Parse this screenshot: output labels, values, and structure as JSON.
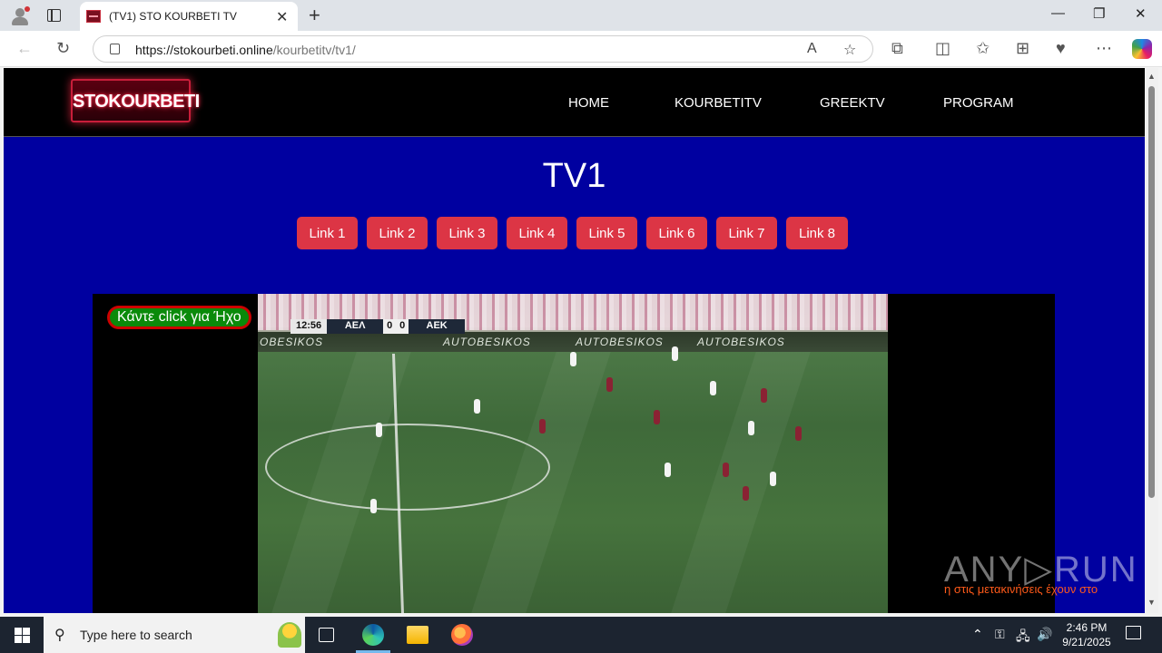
{
  "browser": {
    "tab_title": "(TV1) STO KOURBETI TV",
    "tab_close": "✕",
    "new_tab": "+",
    "url_host": "https://stokourbeti.online",
    "url_path": "/kourbetitv/tv1/",
    "window_controls": [
      "—",
      "❐",
      "✕"
    ]
  },
  "site": {
    "logo": "STOKOURBETI",
    "nav": [
      "HOME",
      "KOURBETITV",
      "GREEKTV",
      "PROGRAM"
    ],
    "page_title": "TV1",
    "links": [
      "Link 1",
      "Link 2",
      "Link 3",
      "Link 4",
      "Link 5",
      "Link 6",
      "Link 7",
      "Link 8"
    ],
    "sound_button": "Κάντε click για Ήχο",
    "marquee": "η στις μετακινήσεις έχουν στο",
    "watermark": "ANY▷RUN"
  },
  "video": {
    "scoreboard": {
      "time": "12:56",
      "home": "ΑΕΛ",
      "home_score": "0",
      "away_score": "0",
      "away": "ΑΕΚ"
    },
    "ad_text": [
      "OBESIKOS",
      "AUTOBESIKOS",
      "AUTOBESIKOS",
      "AUTOBESIKOS"
    ]
  },
  "taskbar": {
    "search_placeholder": "Type here to search",
    "time": "2:46 PM",
    "date": "9/21/2025"
  },
  "colors": {
    "page_background": "#0000a0",
    "link_button": "#dc3545",
    "header_background": "#000000",
    "sound_button": "#0a8a0a"
  }
}
